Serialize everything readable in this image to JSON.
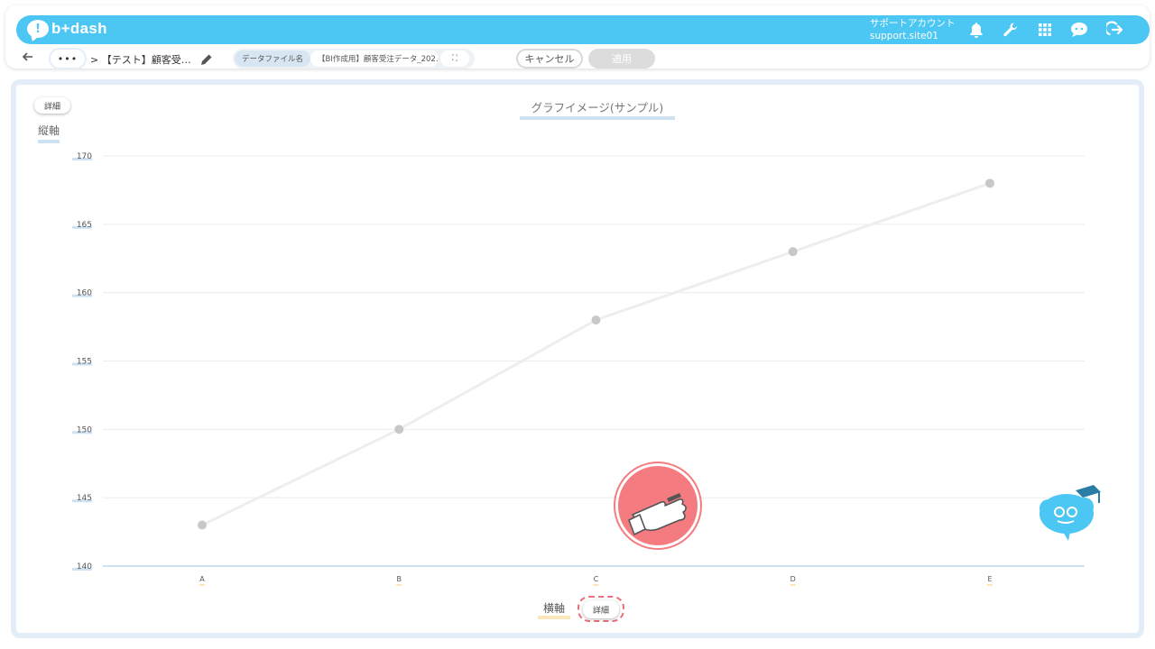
{
  "app": {
    "logo_text": "b+dash",
    "account_label": "サポートアカウント",
    "account_id": "support.site01",
    "brand_color": "#4cc6f2"
  },
  "header_icons": [
    "bell-icon",
    "wrench-icon",
    "grid-icon",
    "chat-icon",
    "logout-icon"
  ],
  "toolbar": {
    "breadcrumb_more": "•••",
    "breadcrumb_title": "> 【テスト】顧客受…",
    "datafile_label": "データファイル名",
    "datafile_value": "【BI作成用】顧客受注データ_202…",
    "expand_glyph": "⛶",
    "cancel_label": "キャンセル",
    "apply_label": "適用"
  },
  "panel": {
    "detail_top_label": "詳細",
    "y_axis_title": "縦軸",
    "chart_title": "グラフイメージ(サンプル)",
    "x_axis_title": "横軸",
    "detail_bottom_label": "詳細"
  },
  "chart_data": {
    "type": "line",
    "title": "グラフイメージ(サンプル)",
    "xlabel": "横軸",
    "ylabel": "縦軸",
    "categories": [
      "A",
      "B",
      "C",
      "D",
      "E"
    ],
    "values": [
      143,
      150,
      158,
      163,
      168
    ],
    "ylim": [
      140,
      170
    ],
    "yticks": [
      140,
      145,
      150,
      155,
      160,
      165,
      170
    ],
    "grid": true,
    "legend": "none",
    "line_color": "#eeeeee",
    "point_color": "#c8c8c8"
  }
}
